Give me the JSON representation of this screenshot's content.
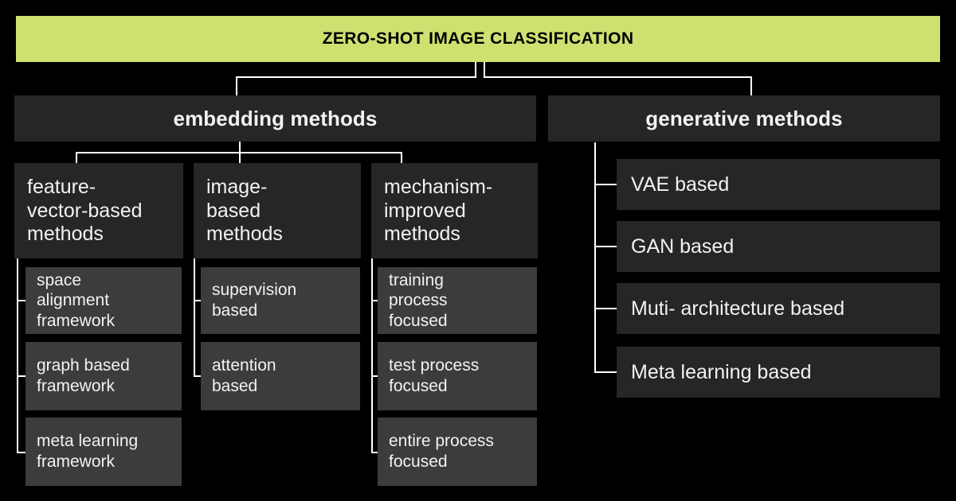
{
  "diagram": {
    "title": "ZERO-SHOT IMAGE CLASSIFICATION",
    "accent_color": "#cde070",
    "background_color": "#000000",
    "node_color": "#262626",
    "leaf_color": "#3c3c3c",
    "connector_color": "#ffffff",
    "text_color": "#f2f2f2"
  },
  "branches": {
    "embedding": {
      "label": "embedding methods",
      "children": [
        {
          "label": "feature-\nvector-based\nmethods",
          "line1": "feature-",
          "line2": "vector-based",
          "line3": "methods",
          "leaves": [
            {
              "line1": "space",
              "line2": "alignment",
              "line3": "framework"
            },
            {
              "line1": "graph based",
              "line2": "framework",
              "line3": ""
            },
            {
              "line1": "meta learning",
              "line2": "framework",
              "line3": ""
            }
          ]
        },
        {
          "label": "image-\nbased\nmethods",
          "line1": "image-",
          "line2": "based",
          "line3": "methods",
          "leaves": [
            {
              "line1": "supervision",
              "line2": "based",
              "line3": ""
            },
            {
              "line1": "attention",
              "line2": "based",
              "line3": ""
            }
          ]
        },
        {
          "label": "mechanism-\nimproved\nmethods",
          "line1": "mechanism-",
          "line2": "improved",
          "line3": "methods",
          "leaves": [
            {
              "line1": "training",
              "line2": "process",
              "line3": "focused"
            },
            {
              "line1": "test process",
              "line2": "focused",
              "line3": ""
            },
            {
              "line1": "entire process",
              "line2": "focused",
              "line3": ""
            }
          ]
        }
      ]
    },
    "generative": {
      "label": "generative methods",
      "leaves": [
        {
          "label": "VAE based"
        },
        {
          "label": "GAN based"
        },
        {
          "label": "Muti- architecture based"
        },
        {
          "label": "Meta learning based"
        }
      ]
    }
  }
}
